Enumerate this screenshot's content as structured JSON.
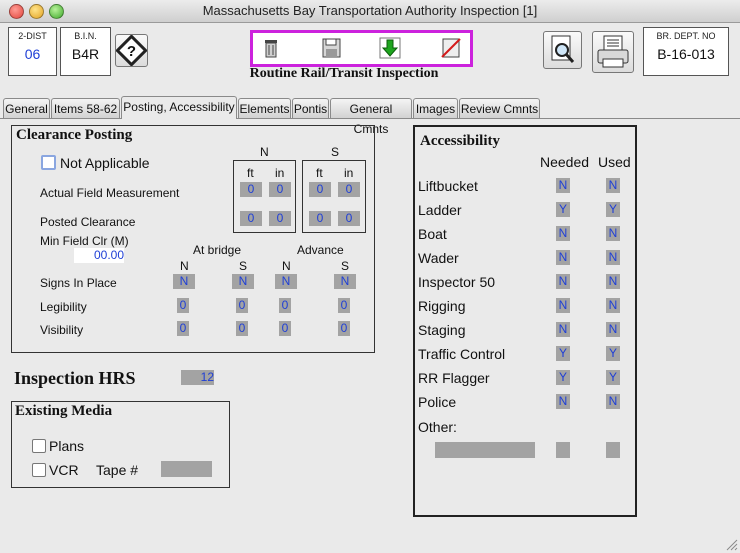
{
  "window": {
    "title": "Massachusetts Bay Transportation Authority Inspection [1]"
  },
  "header": {
    "dist_label": "2-DIST",
    "dist_value": "06",
    "bin_label": "B.I.N.",
    "bin_value": "B4R",
    "dept_label": "BR. DEPT. NO",
    "dept_value": "B-16-013",
    "form_title": "Routine Rail/Transit Inspection"
  },
  "tabs": [
    {
      "label": "General"
    },
    {
      "label": "Items 58-62"
    },
    {
      "label": "Posting, Accessibility"
    },
    {
      "label": "Elements"
    },
    {
      "label": "Pontis"
    },
    {
      "label": "General Cmnts"
    },
    {
      "label": "Images"
    },
    {
      "label": "Review Cmnts"
    }
  ],
  "clearance": {
    "title": "Clearance Posting",
    "not_applicable": "Not Applicable",
    "actual_field": "Actual Field Measurement",
    "posted_clearance": "Posted Clearance",
    "min_field_label": "Min Field Clr (M)",
    "min_field_value": "00.00",
    "n_label": "N",
    "s_label": "S",
    "ft": "ft",
    "in": "in",
    "actual_vals": [
      "0",
      "0",
      "0",
      "0"
    ],
    "posted_vals": [
      "0",
      "0",
      "0",
      "0"
    ],
    "at_bridge": "At bridge",
    "advance": "Advance",
    "cols": [
      "N",
      "S",
      "N",
      "S"
    ],
    "signs_label": "Signs In Place",
    "signs": [
      "N",
      "N",
      "N",
      "N"
    ],
    "legibility_label": "Legibility",
    "legibility": [
      "0",
      "0",
      "0",
      "0"
    ],
    "visibility_label": "Visibility",
    "visibility": [
      "0",
      "0",
      "0",
      "0"
    ]
  },
  "inspection": {
    "label": "Inspection HRS",
    "value": "12"
  },
  "media": {
    "title": "Existing Media",
    "plans": "Plans",
    "vcr": "VCR",
    "tape": "Tape #"
  },
  "accessibility": {
    "title": "Accessibility",
    "needed": "Needed",
    "used": "Used",
    "rows": [
      {
        "label": "Liftbucket",
        "needed": "N",
        "used": "N"
      },
      {
        "label": "Ladder",
        "needed": "Y",
        "used": "Y"
      },
      {
        "label": "Boat",
        "needed": "N",
        "used": "N"
      },
      {
        "label": "Wader",
        "needed": "N",
        "used": "N"
      },
      {
        "label": "Inspector 50",
        "needed": "N",
        "used": "N"
      },
      {
        "label": "Rigging",
        "needed": "N",
        "used": "N"
      },
      {
        "label": "Staging",
        "needed": "N",
        "used": "N"
      },
      {
        "label": "Traffic Control",
        "needed": "Y",
        "used": "Y"
      },
      {
        "label": "RR Flagger",
        "needed": "Y",
        "used": "Y"
      },
      {
        "label": "Police",
        "needed": "N",
        "used": "N"
      }
    ],
    "other": "Other:"
  }
}
